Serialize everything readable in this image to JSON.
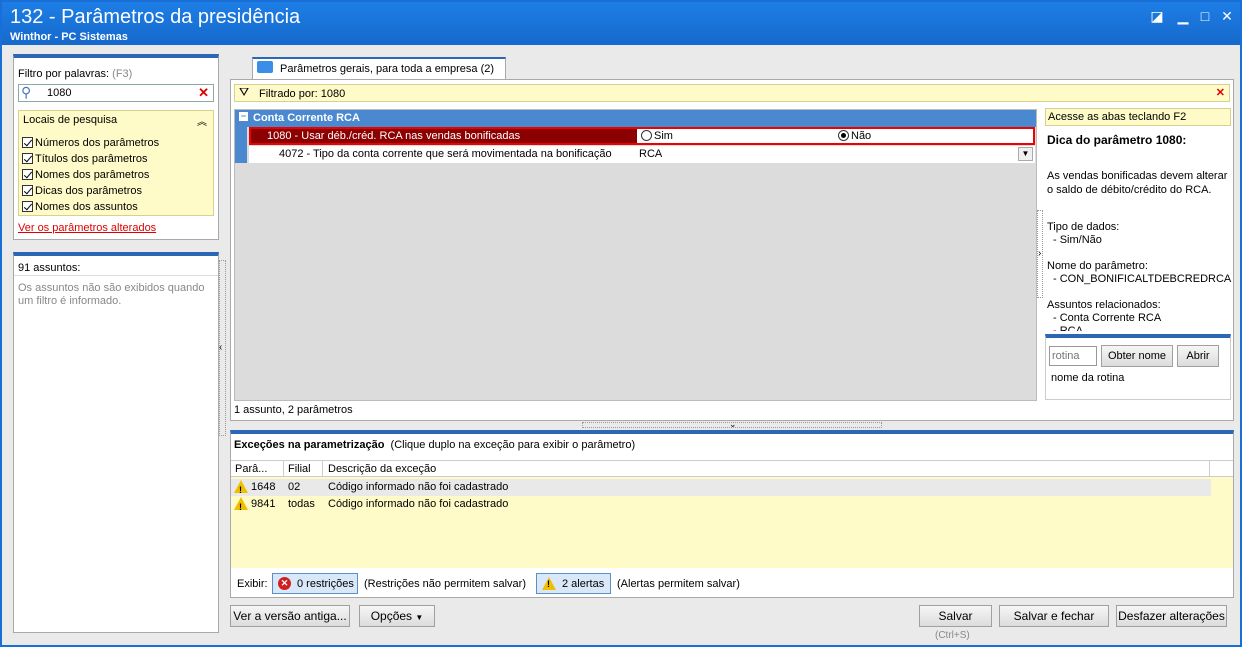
{
  "window": {
    "title": "132 - Parâmetros da presidência",
    "subtitle": "Winthor - PC Sistemas"
  },
  "left": {
    "filter_label": "Filtro por palavras:",
    "filter_shortcut": "(F3)",
    "search_value": "1080",
    "locais_title": "Locais de pesquisa",
    "locais": [
      "Números dos parâmetros",
      "Títulos dos parâmetros",
      "Nomes dos parâmetros",
      "Dicas dos parâmetros",
      "Nomes dos assuntos"
    ],
    "changed_link": "Ver os parâmetros alterados",
    "assuntos_count": "91 assuntos:",
    "assuntos_note": "Os assuntos não são exibidos quando um filtro é informado."
  },
  "tab": {
    "label": "Parâmetros gerais, para toda a empresa",
    "count": "(2)"
  },
  "filterbar": {
    "text": "Filtrado por: 1080"
  },
  "grid": {
    "group": "Conta Corrente RCA",
    "rows": [
      {
        "label": "1080 - Usar déb./créd. RCA nas vendas bonificadas",
        "opt_sim": "Sim",
        "opt_nao": "Não"
      },
      {
        "label": "4072 - Tipo da conta corrente que será movimentada na bonificação",
        "value": "RCA"
      }
    ],
    "status": "1 assunto, 2 parâmetros"
  },
  "right": {
    "hint": "Acesse as abas teclando F2",
    "dica_title": "Dica do parâmetro 1080:",
    "dica_text": "As vendas bonificadas devem alterar o saldo de débito/crédito do RCA.",
    "tipo_label": "Tipo de dados:",
    "tipo_value": "- Sim/Não",
    "nome_label": "Nome do parâmetro:",
    "nome_value": "- CON_BONIFICALTDEBCREDRCA",
    "assuntos_label": "Assuntos relacionados:",
    "assuntos_value": "- Conta Corrente RCA",
    "assuntos_value2": "- RCA",
    "rotina_placeholder": "rotina",
    "obter_nome": "Obter nome",
    "abrir": "Abrir",
    "nome_rotina": "nome da rotina"
  },
  "exceptions": {
    "title": "Exceções na parametrização",
    "subtitle": "(Clique duplo na exceção para exibir o parâmetro)",
    "columns": [
      "Parâ...",
      "Filial",
      "Descrição da exceção"
    ],
    "rows": [
      {
        "param": "1648",
        "filial": "02",
        "desc": "Código informado não foi cadastrado"
      },
      {
        "param": "9841",
        "filial": "todas",
        "desc": "Código informado não foi cadastrado"
      }
    ],
    "exibir": "Exibir:",
    "restricoes_btn": "0 restrições",
    "restricoes_note": "(Restrições não permitem salvar)",
    "alertas_btn": "2 alertas",
    "alertas_note": "(Alertas permitem salvar)"
  },
  "footer": {
    "versao_antiga": "Ver a versão antiga...",
    "opcoes": "Opções",
    "salvar": "Salvar",
    "salvar_shortcut": "(Ctrl+S)",
    "salvar_fechar": "Salvar e fechar",
    "desfazer": "Desfazer alterações"
  },
  "colors": {
    "title": "#1a6fd6",
    "selected_row": "#8b0000",
    "group": "#4a88d0",
    "yellow": "#fffbc8"
  }
}
